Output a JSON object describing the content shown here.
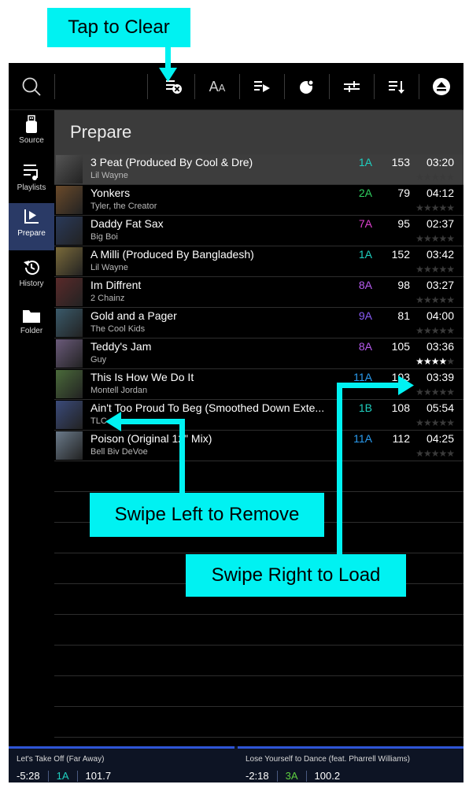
{
  "callouts": {
    "tap_to_clear": "Tap to Clear",
    "swipe_left": "Swipe Left to Remove",
    "swipe_right": "Swipe Right to Load"
  },
  "toolbar": {
    "font_size_label": "A",
    "font_size_label_small": "A",
    "icons": [
      "search-icon",
      "clear-list-icon",
      "font-size-icon",
      "add-to-queue-icon",
      "toggle-icon",
      "filter-icon",
      "sort-icon",
      "eject-icon"
    ]
  },
  "sidebar": {
    "items": [
      {
        "label": "Source",
        "icon": "usb-drive-icon",
        "active": false
      },
      {
        "label": "Playlists",
        "icon": "playlist-icon",
        "active": false
      },
      {
        "label": "Prepare",
        "icon": "prepare-icon",
        "active": true
      },
      {
        "label": "History",
        "icon": "history-icon",
        "active": false
      },
      {
        "label": "Folder",
        "icon": "folder-icon",
        "active": false
      }
    ]
  },
  "main": {
    "title": "Prepare"
  },
  "tracks": [
    {
      "title": "3 Peat (Produced By Cool & Dre)",
      "artist": "Lil Wayne",
      "key": "1A",
      "key_color": "#1fd0c0",
      "bpm": "153",
      "time": "03:20",
      "rating": 0,
      "loaded": true
    },
    {
      "title": "Yonkers",
      "artist": "Tyler, the Creator",
      "key": "2A",
      "key_color": "#2fd060",
      "bpm": "79",
      "time": "04:12",
      "rating": 0,
      "loaded": false
    },
    {
      "title": "Daddy Fat Sax",
      "artist": "Big Boi",
      "key": "7A",
      "key_color": "#e040d0",
      "bpm": "95",
      "time": "02:37",
      "rating": 0,
      "loaded": false
    },
    {
      "title": "A Milli (Produced By Bangladesh)",
      "artist": "Lil Wayne",
      "key": "1A",
      "key_color": "#1fd0c0",
      "bpm": "152",
      "time": "03:42",
      "rating": 0,
      "loaded": false
    },
    {
      "title": "Im Diffrent",
      "artist": "2 Chainz",
      "key": "8A",
      "key_color": "#b85cf0",
      "bpm": "98",
      "time": "03:27",
      "rating": 0,
      "loaded": false
    },
    {
      "title": "Gold and a Pager",
      "artist": "The Cool Kids",
      "key": "9A",
      "key_color": "#8a5cf8",
      "bpm": "81",
      "time": "04:00",
      "rating": 0,
      "loaded": false
    },
    {
      "title": "Teddy's Jam",
      "artist": "Guy",
      "key": "8A",
      "key_color": "#b85cf0",
      "bpm": "105",
      "time": "03:36",
      "rating": 4,
      "loaded": false
    },
    {
      "title": "This Is How We Do It",
      "artist": "Montell Jordan",
      "key": "11A",
      "key_color": "#2a9cf0",
      "bpm": "103",
      "time": "03:39",
      "rating": 0,
      "loaded": false
    },
    {
      "title": "Ain't Too Proud To Beg (Smoothed Down Exte...",
      "artist": "TLC",
      "key": "1B",
      "key_color": "#1fd0c0",
      "bpm": "108",
      "time": "05:54",
      "rating": 0,
      "loaded": false
    },
    {
      "title": "Poison (Original 12\" Mix)",
      "artist": "Bell Biv DeVoe",
      "key": "11A",
      "key_color": "#2a9cf0",
      "bpm": "112",
      "time": "04:25",
      "rating": 0,
      "loaded": false
    }
  ],
  "decks": {
    "left": {
      "title": "Let's Take Off (Far Away)",
      "time": "-5:28",
      "key": "1A",
      "key_color": "#1fd0c0",
      "bpm": "101.7"
    },
    "right": {
      "title": "Lose Yourself to Dance (feat. Pharrell Williams)",
      "time": "-2:18",
      "key": "3A",
      "key_color": "#5ed040",
      "bpm": "100.2"
    }
  }
}
